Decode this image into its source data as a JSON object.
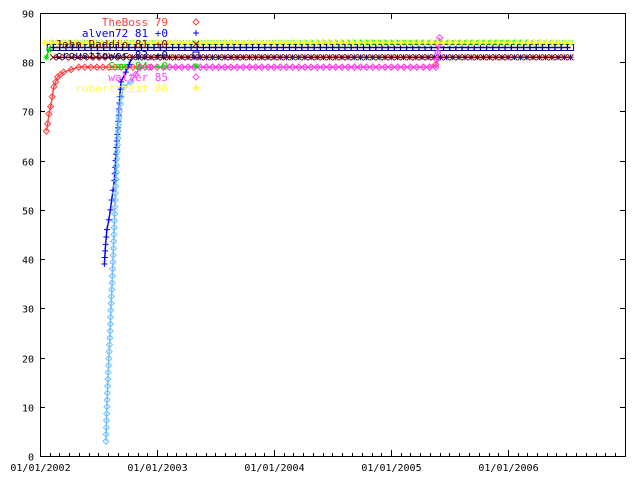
{
  "chart_data": {
    "type": "line",
    "title": "",
    "xlabel": "",
    "ylabel": "",
    "x_type": "date",
    "xlim": [
      "2001-12-31",
      "2007-01-01"
    ],
    "ylim": [
      0,
      90
    ],
    "y_ticks": [
      0,
      10,
      20,
      30,
      40,
      50,
      60,
      70,
      80,
      90
    ],
    "x_ticks": [
      "2002-01-01",
      "2003-01-01",
      "2004-01-01",
      "2005-01-01",
      "2006-01-01"
    ],
    "x_tick_labels": [
      "01/01/2002",
      "01/01/2003",
      "01/01/2004",
      "01/01/2005",
      "01/01/2006"
    ],
    "grid": false,
    "legend_position": "top-left",
    "series": [
      {
        "name": "TheBoss 79",
        "color": "#ff4040",
        "marker": "diamond",
        "points": [
          [
            "2002-01-20",
            66
          ],
          [
            "2002-01-24",
            67.5
          ],
          [
            "2002-01-28",
            69.5
          ],
          [
            "2002-02-02",
            71
          ],
          [
            "2002-02-07",
            73
          ],
          [
            "2002-02-12",
            75
          ],
          [
            "2002-02-18",
            76
          ],
          [
            "2002-02-24",
            77
          ],
          [
            "2002-03-05",
            77.5
          ],
          [
            "2002-03-15",
            78
          ],
          [
            "2002-05-01",
            79
          ],
          [
            "2003-01-01",
            79
          ],
          [
            "2004-01-01",
            79
          ],
          [
            "2005-01-01",
            79
          ],
          [
            "2005-05-01",
            79
          ],
          [
            "2005-05-20",
            79.5
          ]
        ]
      },
      {
        "name": "alven72 81 +0",
        "color": "#0000ff",
        "marker": "plus",
        "points": [
          [
            "2002-07-20",
            39
          ],
          [
            "2002-07-24",
            43
          ],
          [
            "2002-07-28",
            46
          ],
          [
            "2002-08-03",
            48
          ],
          [
            "2002-08-08",
            50
          ],
          [
            "2002-08-12",
            52
          ],
          [
            "2002-08-16",
            54
          ],
          [
            "2002-08-20",
            56
          ],
          [
            "2002-08-24",
            60
          ],
          [
            "2002-08-28",
            64
          ],
          [
            "2002-09-02",
            68
          ],
          [
            "2002-09-06",
            73
          ],
          [
            "2002-09-10",
            76
          ],
          [
            "2002-09-25",
            78
          ],
          [
            "2002-10-15",
            81
          ],
          [
            "2003-01-01",
            81
          ],
          [
            "2004-01-01",
            81
          ],
          [
            "2005-01-01",
            81
          ],
          [
            "2006-01-01",
            81
          ],
          [
            "2006-07-15",
            81
          ]
        ]
      },
      {
        "name": "John Daddio 81 +0",
        "color": "#800000",
        "marker": "x",
        "points": [
          [
            "2002-02-10",
            81
          ],
          [
            "2003-01-01",
            81
          ],
          [
            "2004-01-01",
            81
          ],
          [
            "2005-01-01",
            81
          ],
          [
            "2006-01-01",
            81
          ],
          [
            "2006-07-15",
            81
          ]
        ]
      },
      {
        "name": "crousttower 83 +0",
        "color": "#000080",
        "marker": "square",
        "points": [
          [
            "2002-02-01",
            83
          ],
          [
            "2003-01-01",
            83
          ],
          [
            "2004-01-01",
            83
          ],
          [
            "2005-01-01",
            83
          ],
          [
            "2006-01-01",
            83
          ],
          [
            "2006-07-15",
            83
          ]
        ]
      },
      {
        "name": "Sam 84 +0",
        "color": "#00e000",
        "marker": "asterisk",
        "points": [
          [
            "2002-01-20",
            81
          ],
          [
            "2002-01-28",
            82.5
          ],
          [
            "2002-02-05",
            84
          ],
          [
            "2003-01-01",
            84
          ],
          [
            "2004-01-01",
            84
          ],
          [
            "2005-01-01",
            84
          ],
          [
            "2005-05-20",
            84
          ],
          [
            "2006-01-01",
            84
          ],
          [
            "2006-07-15",
            84
          ]
        ]
      },
      {
        "name": "walter 85",
        "color": "#ff40ff",
        "marker": "diamond",
        "points": [
          [
            "2002-10-10",
            76
          ],
          [
            "2002-11-10",
            79
          ],
          [
            "2003-01-01",
            79
          ],
          [
            "2004-01-01",
            79
          ],
          [
            "2005-01-01",
            79
          ],
          [
            "2005-05-20",
            79
          ],
          [
            "2005-06-01",
            85
          ]
        ]
      },
      {
        "name": "robertrzeit 86",
        "color": "#ffff40",
        "marker": "star",
        "points": [
          [
            "2002-01-15",
            84
          ],
          [
            "2003-01-01",
            84
          ],
          [
            "2004-01-01",
            84
          ],
          [
            "2006-07-15",
            84
          ]
        ]
      },
      {
        "name": "",
        "color": "#70c0ff",
        "marker": "diamond",
        "points": [
          [
            "2002-07-25",
            3
          ],
          [
            "2002-07-28",
            10
          ],
          [
            "2002-08-01",
            17
          ],
          [
            "2002-08-06",
            24
          ],
          [
            "2002-08-10",
            31
          ],
          [
            "2002-08-15",
            38
          ],
          [
            "2002-08-19",
            45
          ],
          [
            "2002-08-23",
            52
          ],
          [
            "2002-08-27",
            59
          ],
          [
            "2002-09-01",
            66
          ],
          [
            "2002-09-05",
            70
          ],
          [
            "2002-09-10",
            73
          ],
          [
            "2002-09-20",
            75
          ],
          [
            "2002-10-10",
            76
          ]
        ]
      }
    ]
  }
}
